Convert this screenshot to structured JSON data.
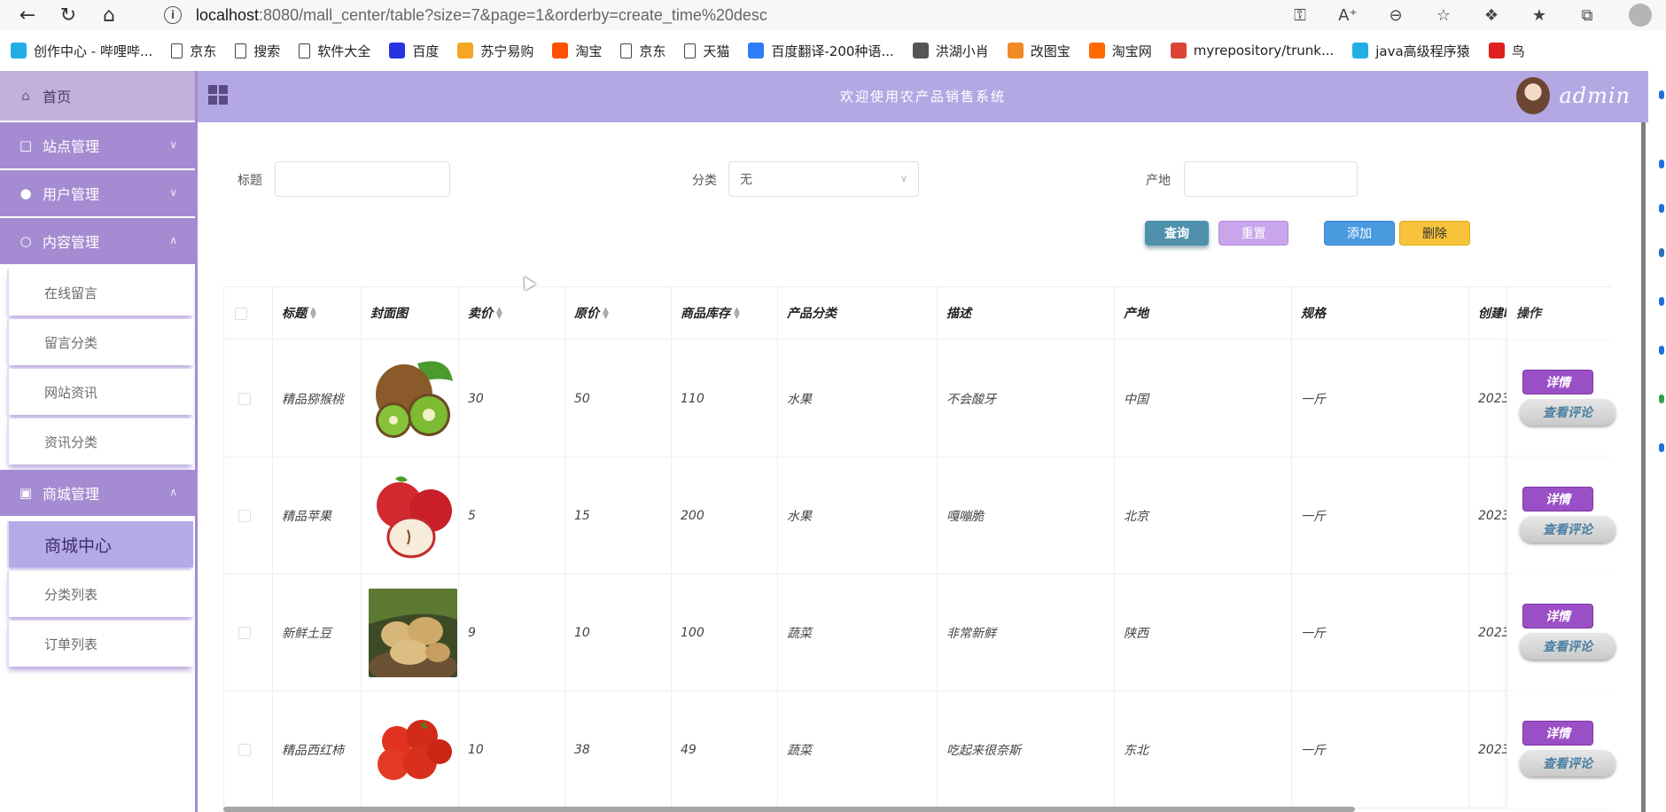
{
  "browser": {
    "url_host": "localhost",
    "url_rest": ":8080/mall_center/table?size=7&page=1&orderby=create_time%20desc",
    "bookmarks": [
      {
        "label": "创作中心 - 哔哩哔...",
        "icon": "bilibili-icon",
        "color": "#23ade5"
      },
      {
        "label": "京东",
        "icon": "page-icon",
        "color": ""
      },
      {
        "label": "搜索",
        "icon": "page-icon",
        "color": ""
      },
      {
        "label": "软件大全",
        "icon": "page-icon",
        "color": ""
      },
      {
        "label": "百度",
        "icon": "baidu-paw-icon",
        "color": "#2932e1"
      },
      {
        "label": "苏宁易购",
        "icon": "suning-icon",
        "color": "#f5a623"
      },
      {
        "label": "淘宝",
        "icon": "taobao-icon",
        "color": "#ff5000"
      },
      {
        "label": "京东",
        "icon": "page-icon",
        "color": ""
      },
      {
        "label": "天猫",
        "icon": "page-icon",
        "color": ""
      },
      {
        "label": "百度翻译-200种语...",
        "icon": "baidu-translate-icon",
        "color": "#2f7cf6"
      },
      {
        "label": "洪湖小肖",
        "icon": "bird-icon",
        "color": "#555555"
      },
      {
        "label": "改图宝",
        "icon": "gaitubao-icon",
        "color": "#f08a24"
      },
      {
        "label": "淘宝网",
        "icon": "taobao-small-icon",
        "color": "#ff6a00"
      },
      {
        "label": "myrepository/trunk...",
        "icon": "chrome-icon",
        "color": "#db4437"
      },
      {
        "label": "java高级程序猿",
        "icon": "bilibili-icon",
        "color": "#23ade5"
      },
      {
        "label": "鸟",
        "icon": "bird-red-icon",
        "color": "#e02020"
      }
    ]
  },
  "sidebar": {
    "home": "首页",
    "groups": [
      {
        "label": "站点管理",
        "icon": "monitor-icon",
        "expanded": false
      },
      {
        "label": "用户管理",
        "icon": "user-icon",
        "expanded": false
      },
      {
        "label": "内容管理",
        "icon": "message-icon",
        "expanded": true
      }
    ],
    "content_items": [
      "在线留言",
      "留言分类",
      "网站资讯",
      "资讯分类"
    ],
    "mall_group": {
      "label": "商城管理",
      "icon": "bag-icon",
      "expanded": true
    },
    "mall_items": [
      {
        "label": "商城中心",
        "active": true
      },
      {
        "label": "分类列表",
        "active": false
      },
      {
        "label": "订单列表",
        "active": false
      }
    ]
  },
  "header": {
    "title": "欢迎使用农产品销售系统",
    "username": "admin"
  },
  "filters": {
    "title_label": "标题",
    "title_value": "",
    "category_label": "分类",
    "category_value": "无",
    "origin_label": "产地",
    "origin_value": ""
  },
  "buttons": {
    "query": "查询",
    "reset": "重置",
    "add": "添加",
    "delete": "删除"
  },
  "table": {
    "columns": [
      "标题",
      "封面图",
      "卖价",
      "原价",
      "商品库存",
      "产品分类",
      "描述",
      "产地",
      "规格",
      "创建时间",
      "操作"
    ],
    "rows": [
      {
        "title": "精品猕猴桃",
        "image": "kiwi",
        "price": "30",
        "original": "50",
        "stock": "110",
        "category": "水果",
        "desc": "不会酸牙",
        "origin": "中国",
        "spec": "一斤",
        "created": "2023"
      },
      {
        "title": "精品苹果",
        "image": "apple",
        "price": "5",
        "original": "15",
        "stock": "200",
        "category": "水果",
        "desc": "嘎嘣脆",
        "origin": "北京",
        "spec": "一斤",
        "created": "2023"
      },
      {
        "title": "新鲜土豆",
        "image": "potato",
        "price": "9",
        "original": "10",
        "stock": "100",
        "category": "蔬菜",
        "desc": "非常新鲜",
        "origin": "陕西",
        "spec": "一斤",
        "created": "2023"
      },
      {
        "title": "精品西红柿",
        "image": "tomato",
        "price": "10",
        "original": "38",
        "stock": "49",
        "category": "蔬菜",
        "desc": "吃起来很奈斯",
        "origin": "东北",
        "spec": "一斤",
        "created": "2023"
      }
    ],
    "detail_label": "详情",
    "review_label": "查看评论"
  },
  "colors": {
    "sidebar_group": "#a58bd1",
    "header": "#b4a8e4",
    "query_button": "#4f91ad",
    "detail_button": "#9b4fc6"
  }
}
